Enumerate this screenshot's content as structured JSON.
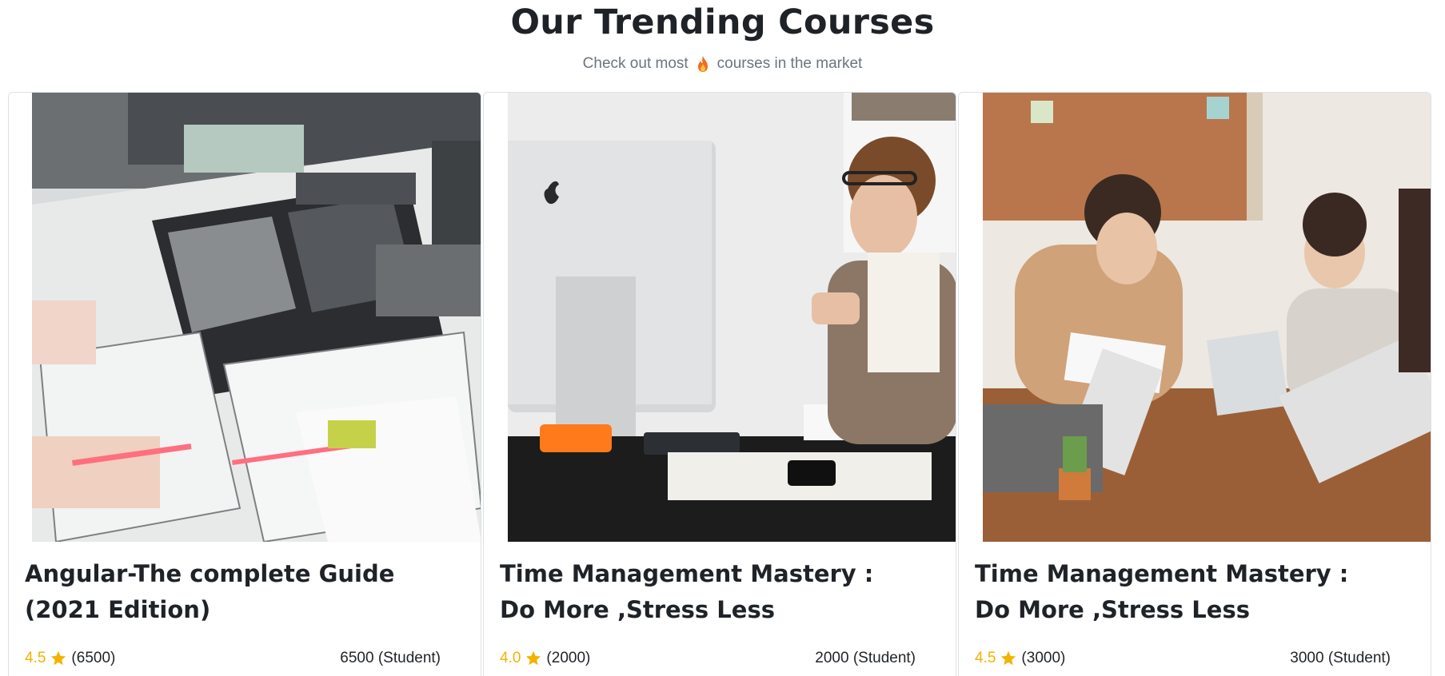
{
  "header": {
    "title": "Our Trending Courses",
    "subtitle_before": "Check out most",
    "subtitle_icon": "fire-icon",
    "subtitle_after": "courses in the market"
  },
  "colors": {
    "rating": "#f0b400",
    "fire": "#f26b1d",
    "border": "#dee2e6"
  },
  "courses": [
    {
      "title": "Angular-The complete Guide (2021 Edition)",
      "image": "people-sketching-on-paper-table",
      "rating": "4.5",
      "reviews": "(6500)",
      "students": "6500 (Student)"
    },
    {
      "title": "Time Management Mastery : Do More ,Stress Less",
      "image": "woman-at-desk-with-computer",
      "rating": "4.0",
      "reviews": "(2000)",
      "students": "2000 (Student)"
    },
    {
      "title": "Time Management Mastery : Do More ,Stress Less",
      "image": "team-meeting-with-laptops",
      "rating": "4.5",
      "reviews": "(3000)",
      "students": "3000 (Student)"
    }
  ]
}
